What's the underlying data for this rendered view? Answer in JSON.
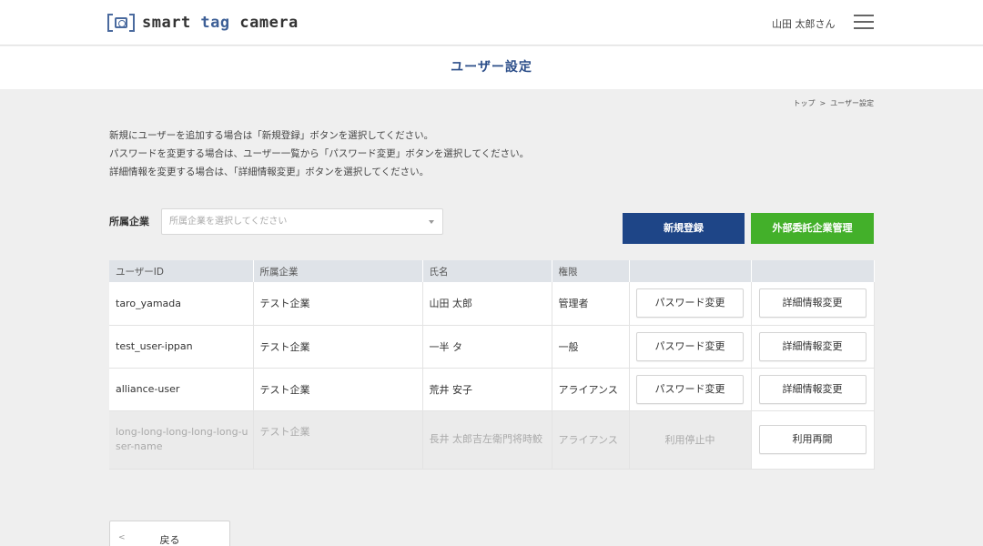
{
  "header": {
    "logo_prefix": "smart ",
    "logo_accent": "tag",
    "logo_suffix": " camera",
    "user_name": "山田 太郎さん"
  },
  "title": "ユーザー設定",
  "breadcrumb": {
    "top": "トップ",
    "separator": ">",
    "current": "ユーザー設定"
  },
  "instructions": [
    "新規にユーザーを追加する場合は「新規登録」ボタンを選択してください。",
    "パスワードを変更する場合は、ユーザー一覧から「パスワード変更」ボタンを選択してください。",
    "詳細情報を変更する場合は、「詳細情報変更」ボタンを選択してください。"
  ],
  "filter": {
    "label": "所属企業",
    "placeholder": "所属企業を選択してください"
  },
  "actions": {
    "new_label": "新規登録",
    "partner_label": "外部委託企業管理"
  },
  "table": {
    "headers": [
      "ユーザーID",
      "所属企業",
      "氏名",
      "権限",
      "",
      ""
    ],
    "rows": [
      {
        "id": "taro_yamada",
        "company": "テスト企業",
        "name": "山田 太郎",
        "role": "管理者",
        "action1": "パスワード変更",
        "action2": "詳細情報変更"
      },
      {
        "id": "test_user-ippan",
        "company": "テスト企業",
        "name": "一半 タ",
        "role": "一般",
        "action1": "パスワード変更",
        "action2": "詳細情報変更"
      },
      {
        "id": "alliance-user",
        "company": "テスト企業",
        "name": "荒井 安子",
        "role": "アライアンス",
        "action1": "パスワード変更",
        "action2": "詳細情報変更"
      },
      {
        "id": "long-long-long-long-long-user-name",
        "company": "テスト企業",
        "name": "長井 太郎吉左衛門将時鮫",
        "role": "アライアンス",
        "status": "利用停止中",
        "action2": "利用再開"
      }
    ]
  },
  "back_label": "戻る",
  "colors": {
    "primary": "#1e4587",
    "success": "#43b02a",
    "header_row": "#dfe3e8"
  }
}
